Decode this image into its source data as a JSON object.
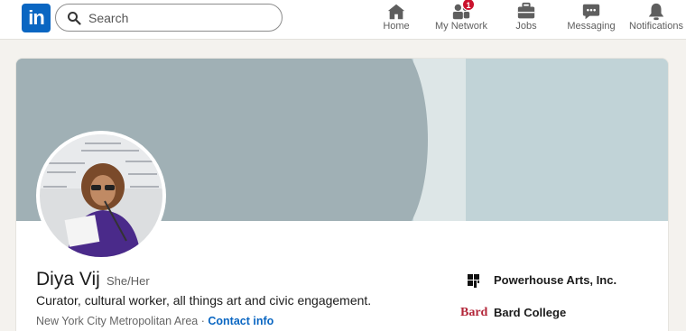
{
  "topnav": {
    "logo_text": "in",
    "search": {
      "placeholder": "Search"
    },
    "items": [
      {
        "label": "Home",
        "icon": "home-icon"
      },
      {
        "label": "My Network",
        "icon": "network-icon",
        "badge": "1"
      },
      {
        "label": "Jobs",
        "icon": "briefcase-icon"
      },
      {
        "label": "Messaging",
        "icon": "message-icon"
      },
      {
        "label": "Notifications",
        "icon": "bell-icon"
      }
    ]
  },
  "profile": {
    "name": "Diya Vij",
    "pronouns": "She/Her",
    "headline": "Curator, cultural worker, all things art and civic engagement.",
    "location": "New York City Metropolitan Area",
    "separator": " · ",
    "contact_label": "Contact info",
    "organizations": [
      {
        "name": "Powerhouse Arts, Inc.",
        "logo": "powerhouse-logo"
      },
      {
        "name": "Bard College",
        "logo": "bard-logo",
        "logo_text": "Bard"
      }
    ]
  },
  "colors": {
    "brand": "#0a66c2",
    "badge": "#cb112d",
    "banner_dark": "#a0b0b5",
    "banner_light": "#c1d3d7",
    "banner_stripe": "#dde6e7",
    "bard_red": "#b22538"
  }
}
